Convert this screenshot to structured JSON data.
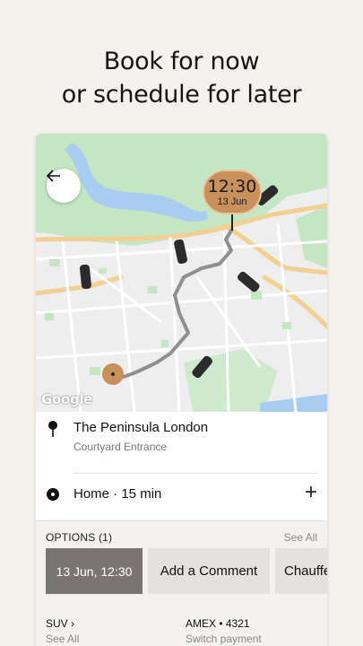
{
  "headline": {
    "line1": "Book for now",
    "line2": "or schedule for later"
  },
  "map": {
    "attribution": "Google",
    "pickup_time": "12:30",
    "pickup_date": "13 Jun",
    "colors": {
      "pin": "#c8905a",
      "route": "#9e9e9e",
      "water": "#a8cdf0",
      "park": "#c7e6c5",
      "road": "#f5cf8e"
    }
  },
  "destination": {
    "title": "The Peninsula London",
    "subtitle": "Courtyard Entrance"
  },
  "home": {
    "label": "Home · 15 min",
    "add_icon": "plus-icon"
  },
  "options": {
    "header": "OPTIONS (1)",
    "see_all": "See All",
    "chips": [
      "13 Jun, 12:30",
      "Add a Comment",
      "Chauffeur"
    ]
  },
  "vehicle": {
    "label": "SUV",
    "sub": "See All"
  },
  "payment": {
    "label": "AMEX • 4321",
    "sub": "Switch payment"
  }
}
